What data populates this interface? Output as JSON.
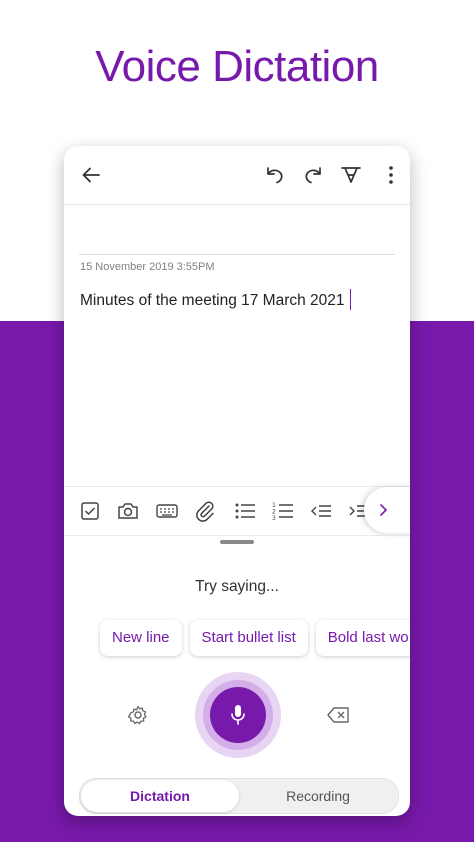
{
  "headline": "Voice Dictation",
  "colors": {
    "accent": "#7719aa",
    "band": "#7719aa"
  },
  "topbar": {
    "icons": [
      "back-arrow-icon",
      "undo-icon",
      "redo-icon",
      "pen-icon",
      "more-vertical-icon"
    ]
  },
  "note": {
    "date": "15 November 2019 3:55PM",
    "body": "Minutes of the meeting 17 March 2021"
  },
  "toolbar": {
    "icons": [
      "checkbox-icon",
      "camera-icon",
      "keyboard-icon",
      "attach-icon",
      "bullet-list-icon",
      "numbered-list-icon",
      "outdent-icon",
      "indent-icon",
      "chevron-right-icon"
    ]
  },
  "dictation": {
    "prompt": "Try saying...",
    "suggestions": [
      "New line",
      "Start bullet list",
      "Bold last wo"
    ],
    "settings_icon": "gear-icon",
    "mic_icon": "microphone-icon",
    "backspace_icon": "backspace-icon"
  },
  "modes": {
    "active": "Dictation",
    "inactive": "Recording"
  }
}
